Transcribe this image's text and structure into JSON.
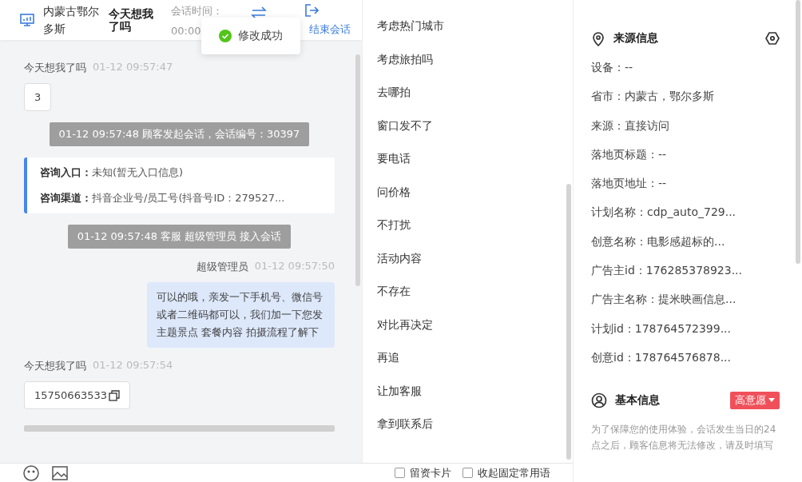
{
  "header": {
    "location": "内蒙古鄂尔多斯",
    "customer": "今天想我了吗",
    "time_label": "会话时间：",
    "time_value": "00:00",
    "end_button": "结束会话"
  },
  "toast": {
    "text": "修改成功"
  },
  "messages": [
    {
      "kind": "customer",
      "sender": "今天想我了吗",
      "time": "01-12 09:57:47",
      "text": "3",
      "copyable": false
    },
    {
      "kind": "system",
      "text": "01-12 09:57:48 顾客发起会话，会话编号：30397"
    },
    {
      "kind": "info",
      "rows": [
        {
          "label": "咨询入口：",
          "value": "未知(暂无入口信息)"
        },
        {
          "label": "咨询渠道：",
          "value": "抖音企业号/员工号(抖音号ID：279527..."
        }
      ]
    },
    {
      "kind": "system",
      "text": "01-12 09:57:48 客服 超级管理员 接入会话"
    },
    {
      "kind": "agent",
      "sender": "超级管理员",
      "time": "01-12 09:57:50",
      "text": "可以的哦，亲发一下手机号、微信号或者二维码都可以，我们加一下您发主题景点 套餐内容 拍摄流程了解下"
    },
    {
      "kind": "customer",
      "sender": "今天想我了吗",
      "time": "01-12 09:57:54",
      "text": "15750663533",
      "copyable": true
    }
  ],
  "phrases": [
    "考虑热门城市",
    "考虑旅拍吗",
    "去哪拍",
    "窗口发不了",
    "要电话",
    "问价格",
    "不打扰",
    "活动内容",
    "不存在",
    "对比再决定",
    "再追",
    "让加客服",
    "拿到联系后"
  ],
  "toolbar": {
    "options": [
      {
        "label": "留资卡片",
        "checked": false
      },
      {
        "label": "收起固定常用语",
        "checked": false
      }
    ]
  },
  "source_info": {
    "title": "来源信息",
    "fields": [
      "设备：--",
      "省市：内蒙古，鄂尔多斯",
      "来源：直接访问",
      "落地页标题：--",
      "落地页地址：--",
      "计划名称：cdp_auto_729...",
      "创意名称：电影感超标的...",
      "广告主id：176285378923...",
      "广告主名称：提米映画信息...",
      "计划id：178764572399...",
      "创意id：178764576878..."
    ]
  },
  "basic_info": {
    "title": "基本信息",
    "tag": "高意愿",
    "hint": "为了保障您的使用体验，会话发生当日的24点之后，顾客信息将无法修改，请及时填写"
  }
}
